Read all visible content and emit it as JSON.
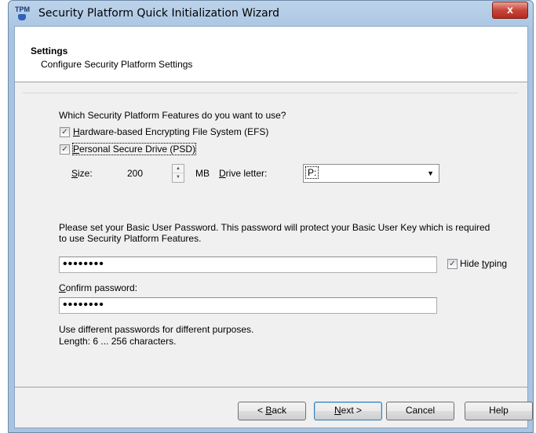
{
  "window": {
    "title": "Security Platform Quick Initialization Wizard",
    "app_icon_text": "TPM",
    "close_label": "x"
  },
  "header": {
    "title": "Settings",
    "subtitle": "Configure Security Platform Settings"
  },
  "features": {
    "question": "Which Security Platform Features do you want to use?",
    "efs": {
      "checked": true,
      "label_accel": "H",
      "label_rest": "ardware-based Encrypting File System (EFS)"
    },
    "psd": {
      "checked": true,
      "label_accel": "P",
      "label_rest": "ersonal Secure Drive (PSD)"
    },
    "size_label_accel": "S",
    "size_label_rest": "ize:",
    "size_value": "200",
    "size_unit": "MB",
    "drive_label_accel": "D",
    "drive_label_rest": "rive letter:",
    "drive_value": "P:"
  },
  "password": {
    "instructions_line1": "Please set your Basic User Password. This password will protect your Basic User Key which is required",
    "instructions_line2": "to use Security Platform Features.",
    "password_value": "••••••••",
    "hide_typing_checked": true,
    "hide_typing_prefix": "Hide ",
    "hide_typing_accel": "t",
    "hide_typing_rest": "yping",
    "confirm_label_accel": "C",
    "confirm_label_rest": "onfirm password:",
    "confirm_value": "••••••••",
    "hint_line1": "Use different passwords for different purposes.",
    "hint_line2": "Length: 6 ... 256 characters."
  },
  "buttons": {
    "back_prefix": "< ",
    "back_accel": "B",
    "back_rest": "ack",
    "next_accel": "N",
    "next_rest": "ext >",
    "cancel": "Cancel",
    "help": "Help"
  }
}
